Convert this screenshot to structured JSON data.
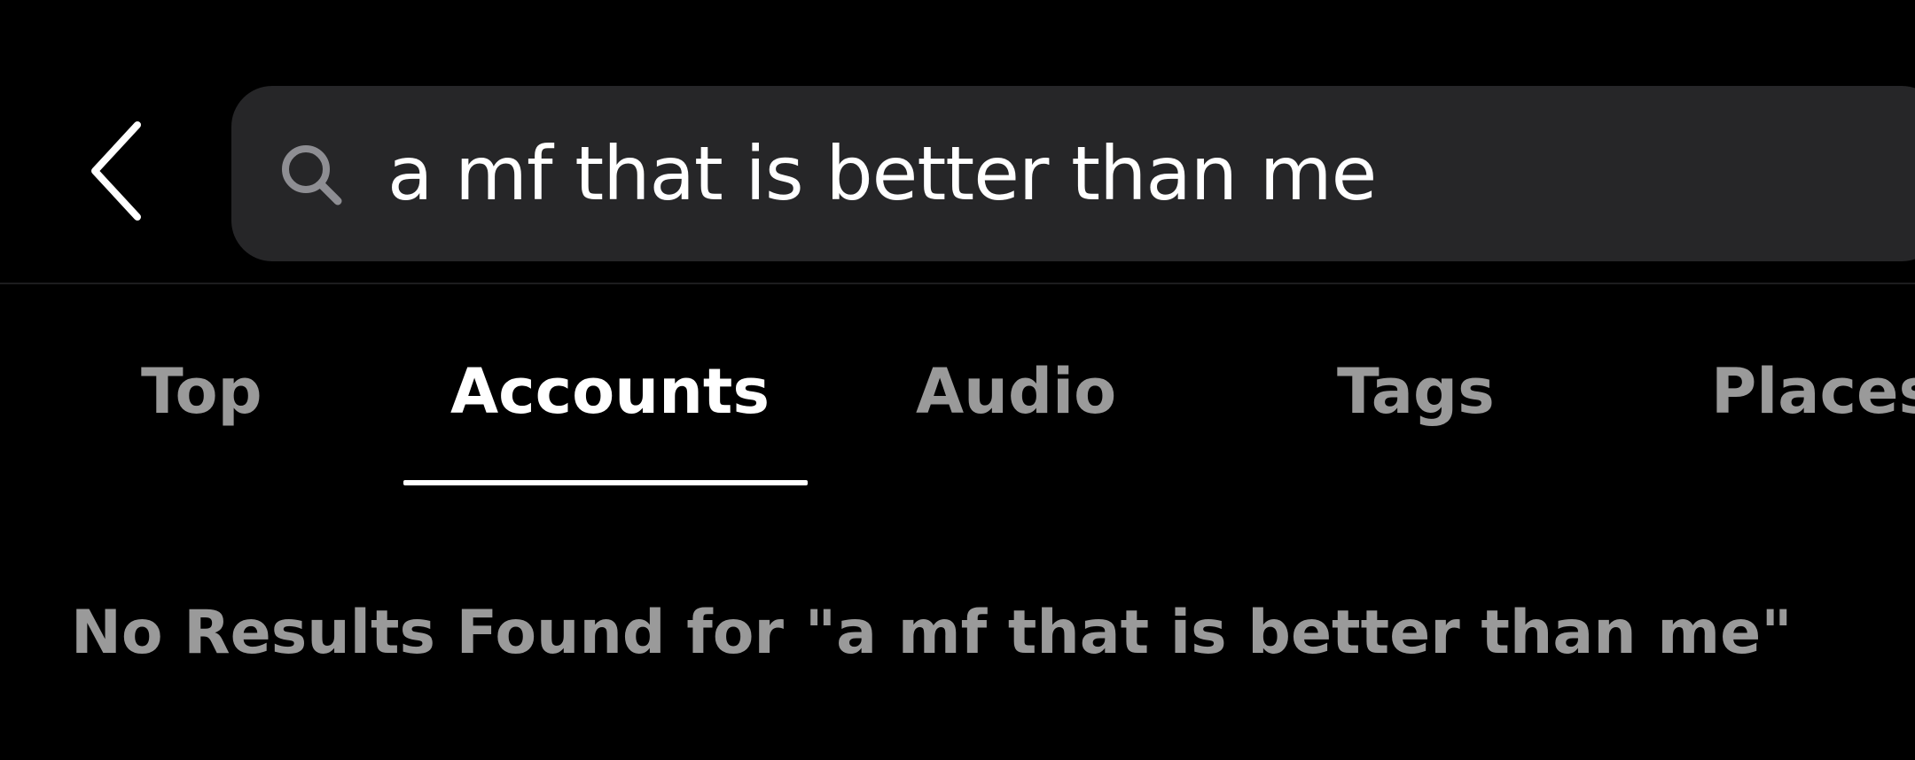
{
  "header": {
    "back_icon": "chevron-left-icon",
    "search": {
      "icon": "search-icon",
      "value": "a mf that is better than me",
      "placeholder": ""
    }
  },
  "tabs": [
    {
      "label": "Top",
      "active": false
    },
    {
      "label": "Accounts",
      "active": true
    },
    {
      "label": "Audio",
      "active": false
    },
    {
      "label": "Tags",
      "active": false
    },
    {
      "label": "Places",
      "active": false
    }
  ],
  "main": {
    "empty_message": "No Results Found for \"a mf that is better than me\""
  },
  "colors": {
    "background": "#000000",
    "search_field": "#262628",
    "active_tab": "#ffffff",
    "inactive_tab": "#9a9a9a",
    "empty_text": "#9a9a9a"
  }
}
